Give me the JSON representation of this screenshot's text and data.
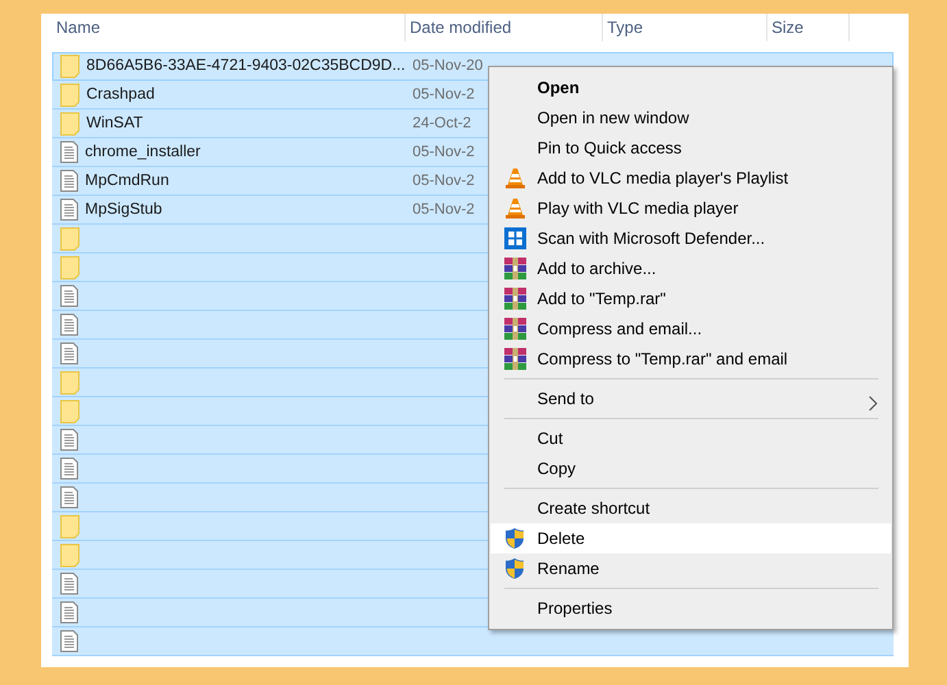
{
  "columns": [
    {
      "label": "Name"
    },
    {
      "label": "Date modified"
    },
    {
      "label": "Type"
    },
    {
      "label": "Size"
    }
  ],
  "rows": [
    {
      "kind": "folder",
      "name": "8D66A5B6-33AE-4721-9403-02C35BCD9D...",
      "date_modified": "05-Nov-20",
      "selected": true,
      "focused": true
    },
    {
      "kind": "folder",
      "name": "Crashpad",
      "date_modified": "05-Nov-2",
      "selected": true,
      "focused": false
    },
    {
      "kind": "folder",
      "name": "WinSAT",
      "date_modified": "24-Oct-2",
      "selected": true,
      "focused": false
    },
    {
      "kind": "file",
      "name": "chrome_installer",
      "date_modified": "05-Nov-2",
      "selected": true,
      "focused": false
    },
    {
      "kind": "file",
      "name": "MpCmdRun",
      "date_modified": "05-Nov-2",
      "selected": true,
      "focused": false
    },
    {
      "kind": "file",
      "name": "MpSigStub",
      "date_modified": "05-Nov-2",
      "selected": true,
      "focused": false
    },
    {
      "kind": "folder",
      "selected": true,
      "focused": false
    },
    {
      "kind": "folder",
      "selected": true,
      "focused": false
    },
    {
      "kind": "file",
      "selected": true,
      "focused": false
    },
    {
      "kind": "file",
      "selected": true,
      "focused": false
    },
    {
      "kind": "file",
      "selected": true,
      "focused": false
    },
    {
      "kind": "folder",
      "selected": true,
      "focused": false
    },
    {
      "kind": "folder",
      "selected": true,
      "focused": false
    },
    {
      "kind": "file",
      "selected": true,
      "focused": false
    },
    {
      "kind": "file",
      "selected": true,
      "focused": false
    },
    {
      "kind": "file",
      "selected": true,
      "focused": false
    },
    {
      "kind": "folder",
      "selected": true,
      "focused": false
    },
    {
      "kind": "folder",
      "selected": true,
      "focused": false
    },
    {
      "kind": "file",
      "selected": true,
      "focused": false
    },
    {
      "kind": "file",
      "selected": true,
      "focused": false
    },
    {
      "kind": "file",
      "selected": true,
      "focused": false
    }
  ],
  "context_menu": {
    "items": [
      {
        "kind": "plain",
        "label": "Open",
        "default": true,
        "selected": false
      },
      {
        "kind": "plain",
        "label": "Open in new window",
        "default": false,
        "selected": false
      },
      {
        "kind": "plain",
        "label": "Pin to Quick access",
        "default": false,
        "selected": false
      },
      {
        "kind": "vlc",
        "label": "Add to VLC media player's Playlist",
        "default": false,
        "selected": false
      },
      {
        "kind": "vlc",
        "label": "Play with VLC media player",
        "default": false,
        "selected": false
      },
      {
        "kind": "defender",
        "label": "Scan with Microsoft Defender...",
        "default": false,
        "selected": false
      },
      {
        "kind": "archive",
        "label": "Add to archive...",
        "default": false,
        "selected": false
      },
      {
        "kind": "archive",
        "label": "Add to \"Temp.rar\"",
        "default": false,
        "selected": false
      },
      {
        "kind": "archive",
        "label": "Compress and email...",
        "default": false,
        "selected": false
      },
      {
        "kind": "archive",
        "label": "Compress to \"Temp.rar\" and email",
        "default": false,
        "selected": false
      },
      {
        "kind": "separator"
      },
      {
        "kind": "submenu",
        "label": "Send to",
        "default": false,
        "selected": false
      },
      {
        "kind": "separator"
      },
      {
        "kind": "plain",
        "label": "Cut",
        "default": false,
        "selected": false
      },
      {
        "kind": "plain",
        "label": "Copy",
        "default": false,
        "selected": false
      },
      {
        "kind": "separator"
      },
      {
        "kind": "plain",
        "label": "Create shortcut",
        "default": false,
        "selected": false
      },
      {
        "kind": "shield",
        "label": "Delete",
        "default": false,
        "selected": true
      },
      {
        "kind": "shield",
        "label": "Rename",
        "default": false,
        "selected": false
      },
      {
        "kind": "separator"
      },
      {
        "kind": "plain",
        "label": "Properties",
        "default": false,
        "selected": false
      }
    ]
  }
}
